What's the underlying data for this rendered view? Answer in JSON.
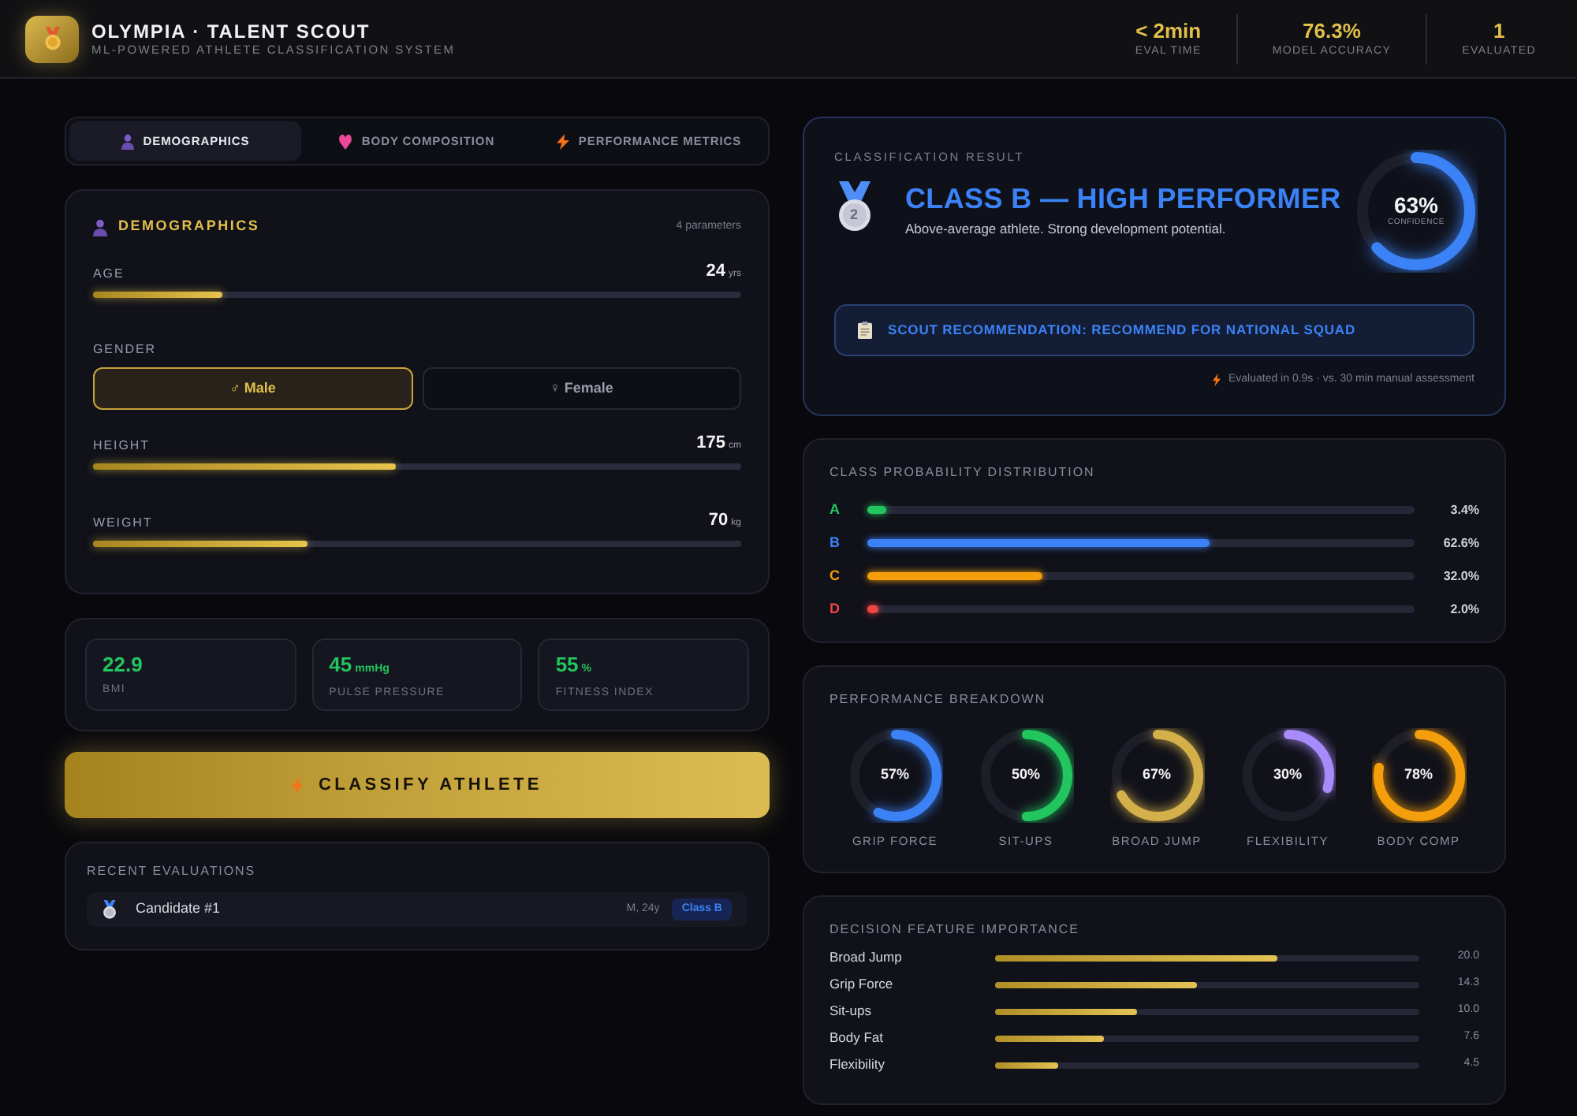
{
  "header": {
    "title": "OLYMPIA · TALENT SCOUT",
    "subtitle": "ML-POWERED ATHLETE CLASSIFICATION SYSTEM",
    "stats": [
      {
        "value": "< 2min",
        "label": "EVAL TIME"
      },
      {
        "value": "76.3%",
        "label": "MODEL ACCURACY"
      },
      {
        "value": "1",
        "label": "EVALUATED"
      }
    ]
  },
  "tabs": [
    {
      "label": "DEMOGRAPHICS",
      "selected": true
    },
    {
      "label": "BODY COMPOSITION",
      "selected": false
    },
    {
      "label": "PERFORMANCE METRICS",
      "selected": false
    }
  ],
  "demographics": {
    "title": "DEMOGRAPHICS",
    "count": "4 parameters",
    "fields": [
      {
        "kind": "slider",
        "label": "AGE",
        "value": "24",
        "unit": "yrs",
        "level": 0.2
      },
      {
        "kind": "choice",
        "label": "GENDER",
        "options": [
          {
            "label": "♂ Male",
            "selected": true
          },
          {
            "label": "♀ Female",
            "selected": false
          }
        ]
      },
      {
        "kind": "slider",
        "label": "HEIGHT",
        "value": "175",
        "unit": "cm",
        "level": 0.466
      },
      {
        "kind": "slider",
        "label": "WEIGHT",
        "value": "70",
        "unit": "kg",
        "level": 0.332
      }
    ]
  },
  "metrics": [
    {
      "value": "22.9",
      "label": "BMI"
    },
    {
      "value": "45",
      "unit": "mmHg",
      "label": "PULSE PRESSURE"
    },
    {
      "value": "55",
      "unit": "%",
      "label": "FITNESS INDEX"
    }
  ],
  "classify_button": {
    "label": "CLASSIFY ATHLETE"
  },
  "recent": {
    "title": "RECENT EVALUATIONS",
    "items": [
      {
        "name": "Candidate #1",
        "meta": "M, 24y",
        "badge": "Class B"
      }
    ]
  },
  "result": {
    "heading": "CLASSIFICATION RESULT",
    "medal_rank": "2",
    "title": "CLASS B — HIGH PERFORMER",
    "description": "Above-average athlete. Strong development potential.",
    "confidence": {
      "value": "63%",
      "label": "CONFIDENCE",
      "level": 0.63
    },
    "recommendation": "SCOUT RECOMMENDATION: RECOMMEND FOR NATIONAL SQUAD",
    "footnote": "Evaluated in 0.9s · vs. 30 min manual assessment"
  },
  "probabilities": {
    "title": "CLASS PROBABILITY DISTRIBUTION",
    "rows": [
      {
        "label": "A",
        "color": "#22c55e",
        "level": 0.034,
        "value": "3.4%"
      },
      {
        "label": "B",
        "color": "#3b82f6",
        "level": 0.626,
        "value": "62.6%"
      },
      {
        "label": "C",
        "color": "#f59e0b",
        "level": 0.32,
        "value": "32.0%"
      },
      {
        "label": "D",
        "color": "#ef4444",
        "level": 0.02,
        "value": "2.0%"
      }
    ]
  },
  "performance": {
    "title": "PERFORMANCE BREAKDOWN",
    "items": [
      {
        "value": "57%",
        "label": "GRIP FORCE",
        "color": "#3b82f6",
        "level": 0.57
      },
      {
        "value": "50%",
        "label": "SIT-UPS",
        "color": "#22c55e",
        "level": 0.5
      },
      {
        "value": "67%",
        "label": "BROAD JUMP",
        "color": "#d4b04a",
        "level": 0.67
      },
      {
        "value": "30%",
        "label": "FLEXIBILITY",
        "color": "#a78bfa",
        "level": 0.3
      },
      {
        "value": "78%",
        "label": "BODY COMP",
        "color": "#f59e0b",
        "level": 0.78
      }
    ]
  },
  "feature_importance": {
    "title": "DECISION FEATURE IMPORTANCE",
    "rows": [
      {
        "label": "Broad Jump",
        "value": "20.0",
        "level": 0.667
      },
      {
        "label": "Grip Force",
        "value": "14.3",
        "level": 0.474
      },
      {
        "label": "Sit-ups",
        "value": "10.0",
        "level": 0.333
      },
      {
        "label": "Body Fat",
        "value": "7.6",
        "level": 0.256
      },
      {
        "label": "Flexibility",
        "value": "4.5",
        "level": 0.148
      }
    ]
  }
}
